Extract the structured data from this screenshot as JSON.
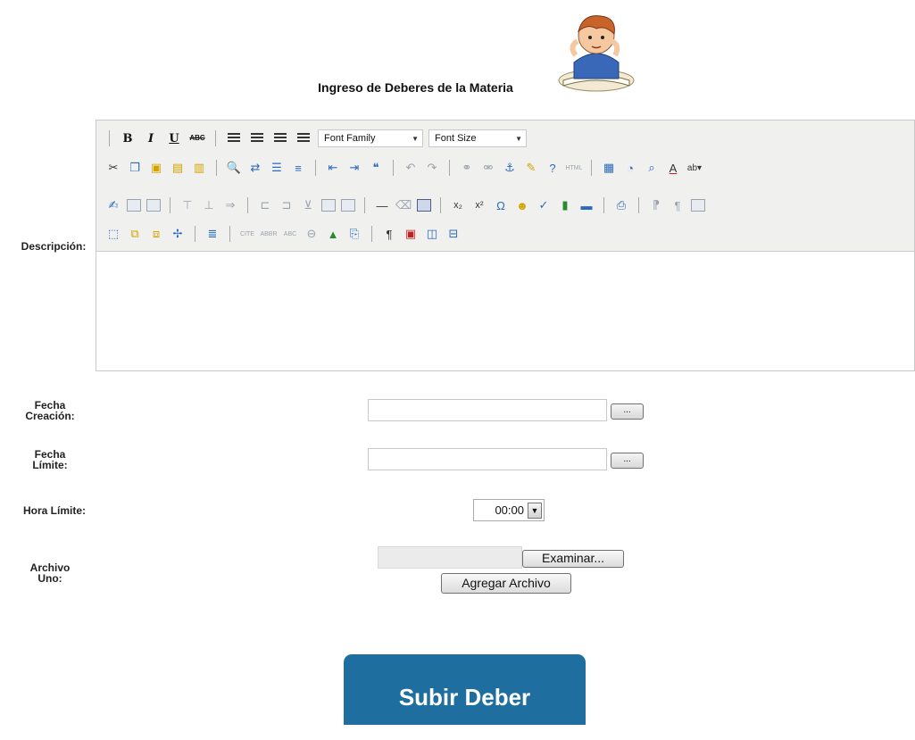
{
  "header": {
    "title": "Ingreso de Deberes de la Materia"
  },
  "labels": {
    "descripcion": "Descripción:",
    "fecha_creacion": [
      "Fecha",
      "Creación:"
    ],
    "fecha_limite": [
      "Fecha",
      "Límite:"
    ],
    "hora_limite": "Hora Límite:",
    "archivo_uno": [
      "Archivo",
      "Uno:"
    ]
  },
  "editor": {
    "font_family": "Font Family",
    "font_size": "Font Size",
    "content": ""
  },
  "fields": {
    "fecha_creacion_value": "",
    "fecha_limite_value": "",
    "picker_label": "...",
    "hora_limite_value": "00:00",
    "file_value": "",
    "browse_label": "Examinar...",
    "add_file_label": "Agregar Archivo"
  },
  "submit_label": "Subir Deber",
  "colors": {
    "submit_bg": "#1e6fa0",
    "toolbar_bg": "#f0f0ee"
  }
}
